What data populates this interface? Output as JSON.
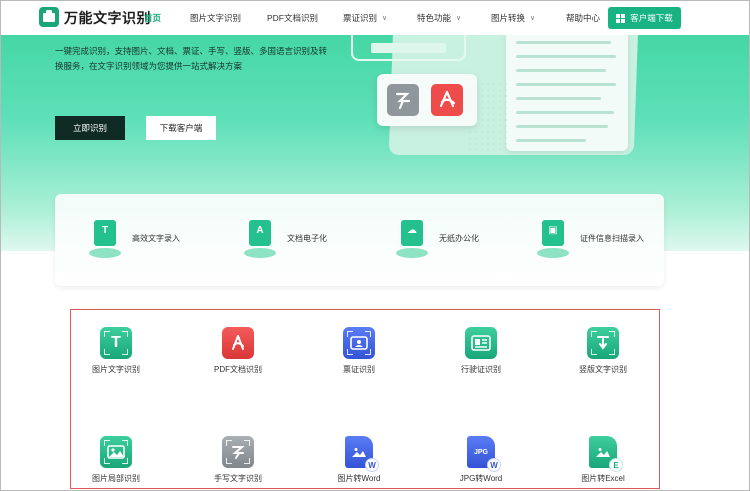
{
  "header": {
    "logo_text": "万能文字识别",
    "nav": [
      {
        "label": "首页",
        "active": true
      },
      {
        "label": "图片文字识别"
      },
      {
        "label": "PDF文档识别"
      },
      {
        "label": "票证识别",
        "dropdown": true
      },
      {
        "label": "特色功能",
        "dropdown": true
      },
      {
        "label": "图片转换",
        "dropdown": true
      },
      {
        "label": "帮助中心"
      }
    ],
    "client_button": "客户端下载"
  },
  "hero": {
    "description": "一键完成识别，支持图片、文档、票证、手写、竖版、多国语言识别及转换服务，在文字识别领域为您提供一站式解决方案",
    "primary_button": "立即识别",
    "secondary_button": "下载客户端"
  },
  "features": [
    {
      "label": "高效文字录入",
      "icon": "text-entry-icon"
    },
    {
      "label": "文档电子化",
      "icon": "document-digitize-icon"
    },
    {
      "label": "无纸办公化",
      "icon": "paperless-office-icon"
    },
    {
      "label": "证件信息扫描录入",
      "icon": "id-scan-icon"
    }
  ],
  "tools": [
    {
      "label": "图片文字识别",
      "icon": "image-text-icon",
      "color": "#18a679"
    },
    {
      "label": "PDF文档识别",
      "icon": "pdf-icon",
      "color": "#d93636"
    },
    {
      "label": "票证识别",
      "icon": "ticket-icon",
      "color": "#3454d6"
    },
    {
      "label": "行驶证识别",
      "icon": "license-icon",
      "color": "#18a679"
    },
    {
      "label": "竖版文字识别",
      "icon": "vertical-text-icon",
      "color": "#18a679"
    },
    {
      "label": "图片局部识别",
      "icon": "image-area-icon",
      "color": "#18a679"
    },
    {
      "label": "手写文字识别",
      "icon": "handwriting-icon",
      "color": "#7f878c"
    },
    {
      "label": "图片转Word",
      "icon": "image-to-word-icon",
      "color": "#3454d6"
    },
    {
      "label": "JPG转Word",
      "icon": "jpg-to-word-icon",
      "color": "#3454d6",
      "file_tag": "JPG"
    },
    {
      "label": "图片转Excel",
      "icon": "image-to-excel-icon",
      "color": "#18a679"
    }
  ]
}
